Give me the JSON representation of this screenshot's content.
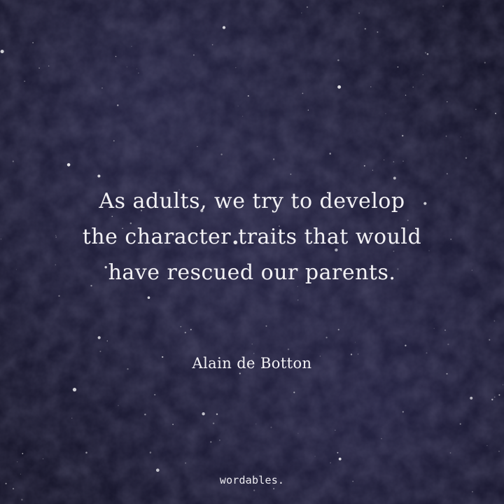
{
  "quote": {
    "lines": [
      "As adults, we try to develop",
      "the character traits that would",
      "have rescued our parents."
    ]
  },
  "author": "Alain de Botton",
  "brand": "wordables.",
  "colors": {
    "background": "#1c1b33",
    "text": "#f2f1f4"
  }
}
